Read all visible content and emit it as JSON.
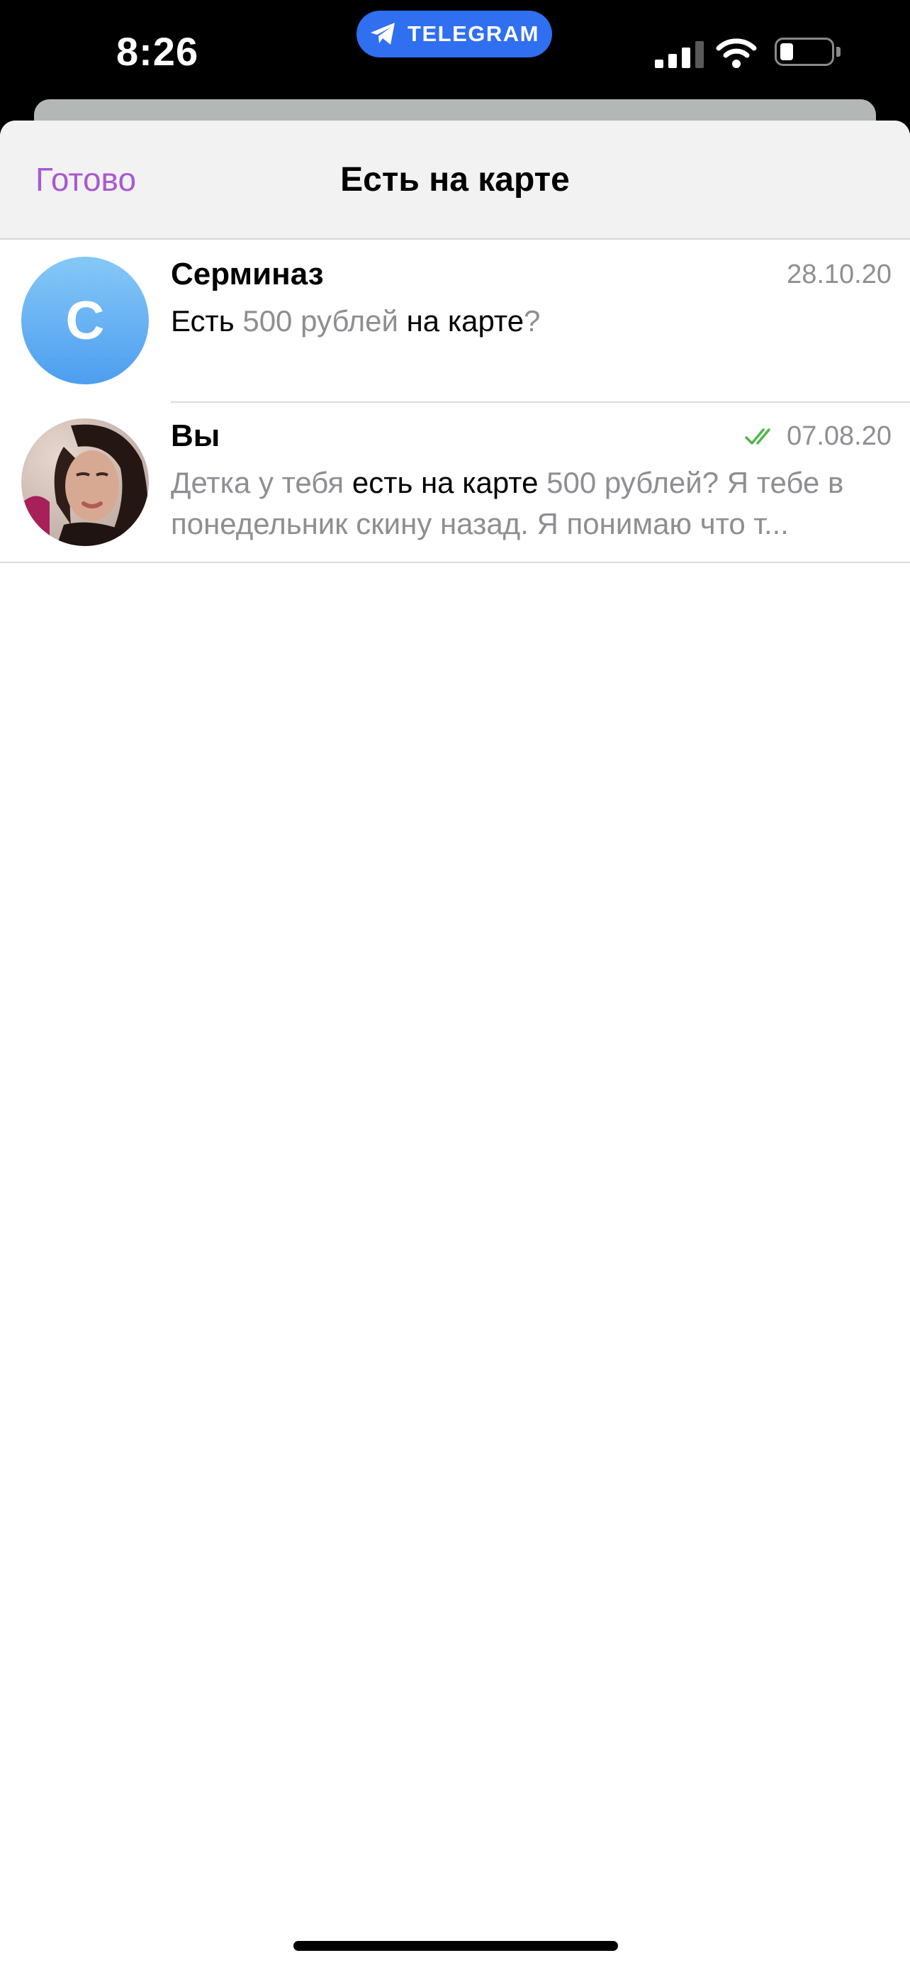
{
  "status_bar": {
    "time": "8:26",
    "app_badge": "TELEGRAM",
    "signal_icon": "cellular-signal-icon",
    "wifi_icon": "wifi-icon",
    "battery_icon": "battery-low-icon",
    "battery_level": 0.2
  },
  "nav": {
    "done_label": "Готово",
    "title": "Есть на карте",
    "accent_color": "#a85ad0"
  },
  "results": [
    {
      "name": "Серминаз",
      "avatar_letter": "С",
      "date": "28.10.20",
      "preview": [
        {
          "text": "Есть",
          "hl": true
        },
        {
          "text": " 500 рублей ",
          "hl": false
        },
        {
          "text": "на карте",
          "hl": true
        },
        {
          "text": "?",
          "hl": false
        }
      ]
    },
    {
      "name": "Вы",
      "avatar_icon": "profile-photo",
      "read_icon": "double-check-icon",
      "read_color": "#4cb84a",
      "date": "07.08.20",
      "preview": [
        {
          "text": "Детка у тебя ",
          "hl": false
        },
        {
          "text": "есть на карте",
          "hl": true
        },
        {
          "text": " 500 рублей? Я тебе в понедельник скину назад. Я понимаю что т...",
          "hl": false
        }
      ]
    }
  ]
}
